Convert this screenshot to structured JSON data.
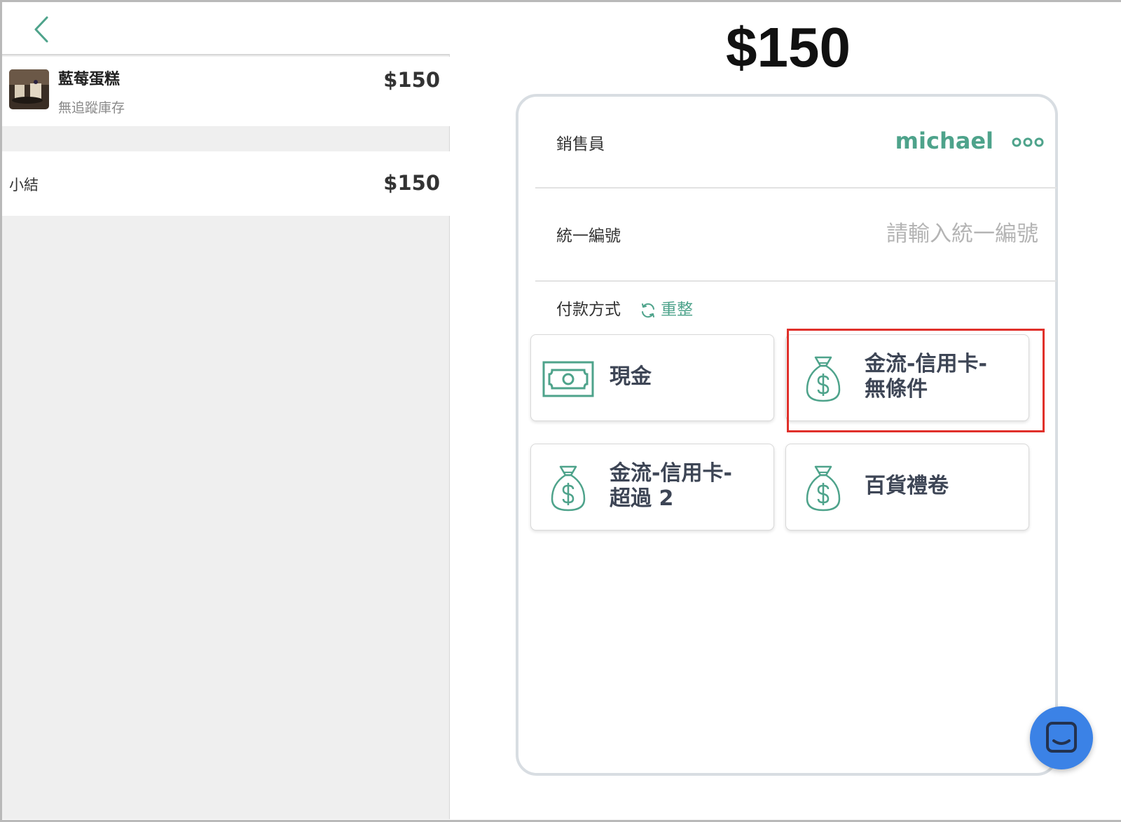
{
  "order": {
    "total": "$150",
    "item": {
      "name": "藍莓蛋糕",
      "stock_note": "無追蹤庫存",
      "price": "$150"
    },
    "subtotal": {
      "label": "小結",
      "value": "$150"
    }
  },
  "checkout": {
    "salesperson_label": "銷售員",
    "salesperson_name": "michael",
    "tax_id_label": "統一編號",
    "tax_id_placeholder": "請輸入統一編號",
    "payment_label": "付款方式",
    "reset_label": "重整",
    "payment_methods": [
      {
        "label": "現金",
        "icon": "cash-icon"
      },
      {
        "label": "金流-信用卡-\n無條件",
        "icon": "money-bag-icon",
        "highlighted": true
      },
      {
        "label": "金流-信用卡-\n超過 2",
        "icon": "money-bag-icon"
      },
      {
        "label": "百貨禮卷",
        "icon": "money-bag-icon"
      }
    ]
  },
  "colors": {
    "accent": "#4ea38b",
    "highlight": "#e0302a",
    "chat": "#3b82e6"
  }
}
